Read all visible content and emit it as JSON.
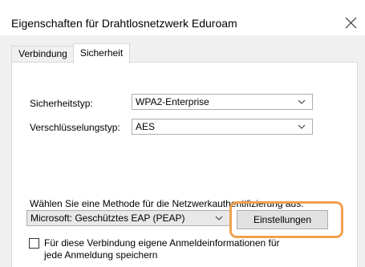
{
  "window": {
    "title": "Eigenschaften für Drahtlosnetzwerk Eduroam"
  },
  "tabs": [
    {
      "label": "Verbindung",
      "active": false
    },
    {
      "label": "Sicherheit",
      "active": true
    }
  ],
  "security": {
    "type_label": "Sicherheitstyp:",
    "type_value": "WPA2-Enterprise",
    "encryption_label": "Verschlüsselungstyp:",
    "encryption_value": "AES"
  },
  "auth": {
    "method_label": "Wählen Sie eine Methode für die Netzwerkauthentifizierung aus:",
    "method_value": "Microsoft: Geschütztes EAP (PEAP)",
    "settings_button": "Einstellungen"
  },
  "remember": {
    "checked": false,
    "label_line1": "Für diese Verbindung eigene Anmeldeinformationen für",
    "label_line2": "jede Anmeldung speichern"
  },
  "colors": {
    "highlight": "#f0a050",
    "panel_background": "#ffffff",
    "dialog_background": "#f0f0f0"
  },
  "icons": {
    "close": "close-icon",
    "dropdown": "chevron-down-icon"
  }
}
